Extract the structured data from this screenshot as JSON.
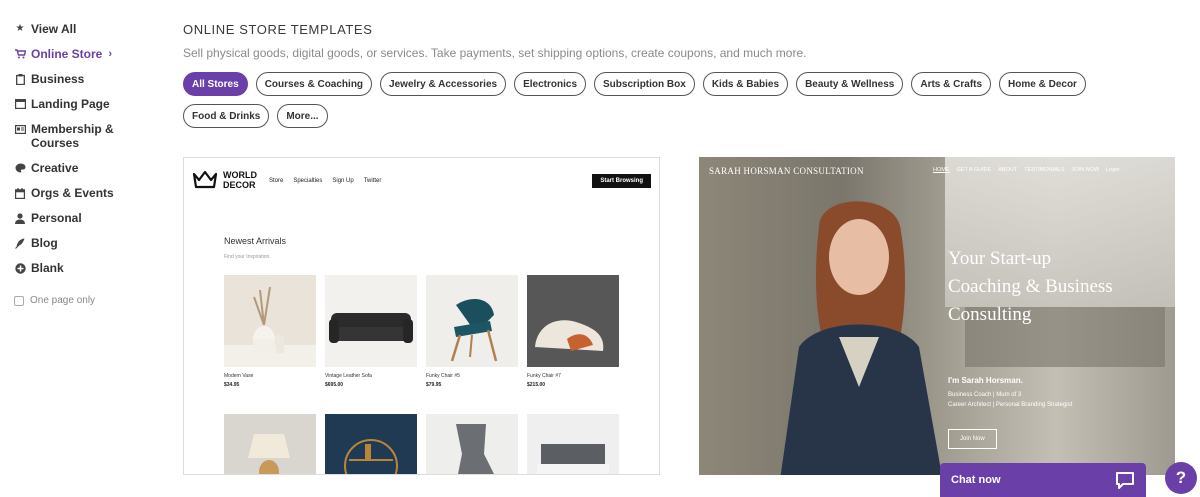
{
  "sidebar": {
    "items": [
      {
        "label": "View All",
        "icon": "star-icon"
      },
      {
        "label": "Online Store",
        "icon": "cart-icon",
        "active": true
      },
      {
        "label": "Business",
        "icon": "clipboard-icon"
      },
      {
        "label": "Landing Page",
        "icon": "window-icon"
      },
      {
        "label": "Membership & Courses",
        "icon": "id-card-icon"
      },
      {
        "label": "Creative",
        "icon": "palette-icon"
      },
      {
        "label": "Orgs & Events",
        "icon": "calendar-icon"
      },
      {
        "label": "Personal",
        "icon": "person-icon"
      },
      {
        "label": "Blog",
        "icon": "feather-icon"
      },
      {
        "label": "Blank",
        "icon": "plus-circle-icon"
      }
    ],
    "one_page_only": "One page only"
  },
  "main": {
    "heading": "ONLINE STORE TEMPLATES",
    "subtitle": "Sell physical goods, digital goods, or services. Take payments, set shipping options, create coupons, and much more.",
    "filters": [
      "All Stores",
      "Courses & Coaching",
      "Jewelry & Accessories",
      "Electronics",
      "Subscription Box",
      "Kids & Babies",
      "Beauty & Wellness",
      "Arts & Crafts",
      "Home & Decor",
      "Food & Drinks",
      "More..."
    ],
    "active_filter": "All Stores"
  },
  "template1": {
    "logo_line1": "WORLD",
    "logo_line2": "DECOR",
    "nav": [
      "Store",
      "Specialties",
      "Sign Up",
      "Twitter"
    ],
    "cta": "Start Browsing",
    "section_title": "Newest Arrivals",
    "section_sub": "Find your Inspiration.",
    "products": [
      {
        "name": "Modern Vase",
        "price": "$34.95"
      },
      {
        "name": "Vintage Leather Sofa",
        "price": "$695.00"
      },
      {
        "name": "Funky Chair #5",
        "price": "$79.95"
      },
      {
        "name": "Funky Chair #7",
        "price": "$215.00"
      }
    ]
  },
  "template2": {
    "brand": "SARAH HORSMAN CONSULTATION",
    "nav": [
      "HOME",
      "GET A GUIDE",
      "ABOUT",
      "TESTIMONIALS",
      "JOIN NOW",
      "Login"
    ],
    "hero_line1": "Your Start-up",
    "hero_line2": "Coaching & Business",
    "hero_line3": "Consulting",
    "name": "I'm Sarah Horsman.",
    "role1": "Business Coach | Mum of 3",
    "role2": "Career Architect | Personal Branding Strategist",
    "join": "Join Now"
  },
  "chat": {
    "label": "Chat now"
  },
  "help": {
    "label": "?"
  },
  "colors": {
    "accent": "#6b3fa8"
  }
}
